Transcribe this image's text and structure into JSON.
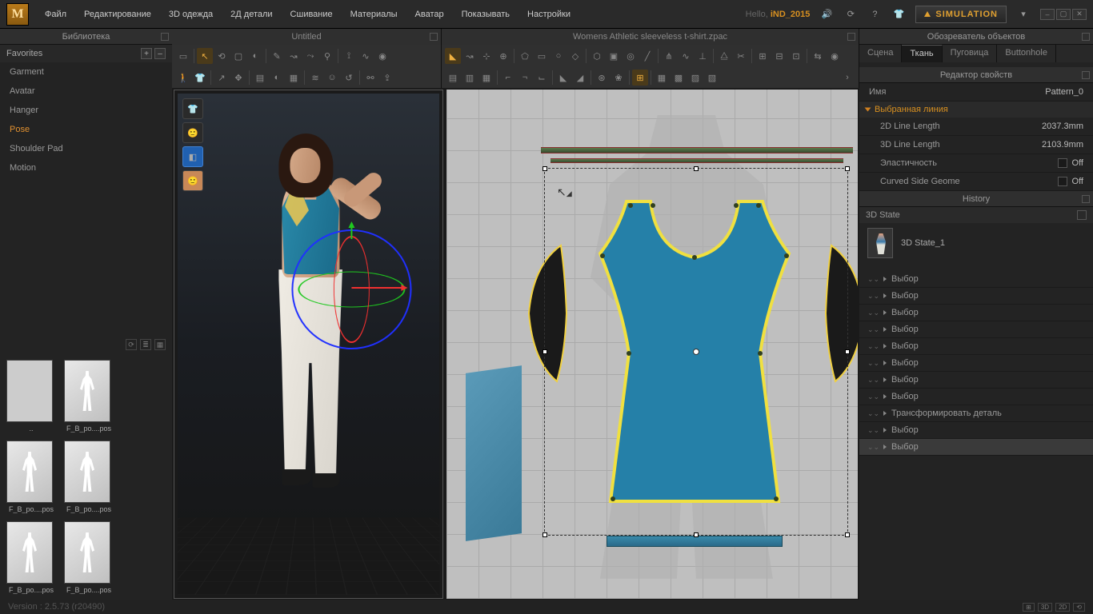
{
  "menu": [
    "Файл",
    "Редактирование",
    "3D одежда",
    "2Д детали",
    "Сшивание",
    "Материалы",
    "Аватар",
    "Показывать",
    "Настройки"
  ],
  "hello_prefix": "Hello, ",
  "username": "iND_2015",
  "simulation_label": "SIMULATION",
  "library": {
    "title": "Библиотека",
    "favorites": "Favorites",
    "categories": [
      "Garment",
      "Avatar",
      "Hanger",
      "Pose",
      "Shoulder Pad",
      "Motion"
    ],
    "active_index": 3,
    "items": [
      "..",
      "F_B_po....pos",
      "F_B_po....pos",
      "F_B_po....pos",
      "F_B_po....pos",
      "F_B_po....pos"
    ]
  },
  "tab3d": "Untitled",
  "tab2d": "Womens Athletic sleeveless t-shirt.zpac",
  "object_browser": {
    "title": "Обозреватель объектов",
    "tabs": [
      "Сцена",
      "Ткань",
      "Пуговица",
      "Buttonhole"
    ],
    "active_tab": 1
  },
  "property_editor": {
    "title": "Редактор свойств",
    "name_label": "Имя",
    "name_value": "Pattern_0",
    "selected_line": "Выбранная линия",
    "rows": [
      {
        "label": "2D Line Length",
        "value": "2037.3mm"
      },
      {
        "label": "3D Line Length",
        "value": "2103.9mm"
      },
      {
        "label": "Эластичность",
        "value": "Off",
        "checkbox": true
      },
      {
        "label": "Curved Side Geome",
        "value": "Off",
        "checkbox": true
      }
    ]
  },
  "history": {
    "title": "History",
    "state_label": "3D State",
    "state_item": "3D State_1",
    "rows": [
      "Выбор",
      "Выбор",
      "Выбор",
      "Выбор",
      "Выбор",
      "Выбор",
      "Выбор",
      "Выбор",
      "Трансформировать деталь",
      "Выбор",
      "Выбор"
    ]
  },
  "version": "Version : 2.5.73   (r20490)"
}
